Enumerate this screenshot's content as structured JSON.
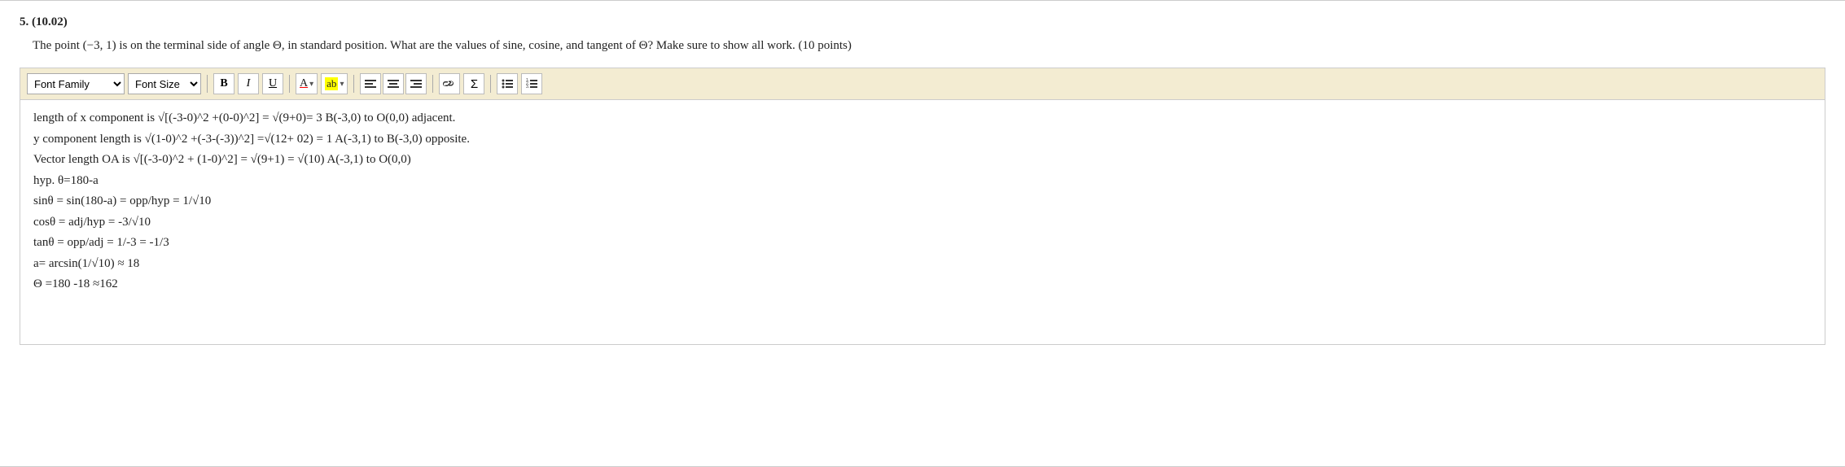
{
  "question": {
    "number": "5.",
    "points": "(10.02)",
    "header": "5. (10.02)",
    "text": "The point (−3, 1) is on the terminal side of angle Θ, in standard position. What are the values of sine, cosine, and tangent of Θ? Make sure to show all work. (10 points)"
  },
  "toolbar": {
    "font_family_label": "Font Family",
    "font_size_label": "Font Size",
    "bold_label": "B",
    "italic_label": "I",
    "underline_label": "U",
    "font_color_label": "A",
    "highlight_label": "ab",
    "align_left_label": "≡",
    "align_center_label": "≡",
    "align_right_label": "≡",
    "link_label": "🔗",
    "sigma_label": "Σ",
    "list_ul_label": "≡",
    "list_ol_label": "≡"
  },
  "content": {
    "lines": [
      " length of x component is √[(-3-0)^2 +(0-0)^2] = √(9+0)= 3  B(-3,0) to O(0,0) adjacent.",
      "y component length is √(1-0)^2 +(-3-(-3))^2] =√(12+ 02) = 1  A(-3,1) to B(-3,0) opposite.",
      "Vector length OA is √[(-3-0)^2 + (1-0)^2] = √(9+1) = √(10)  A(-3,1) to O(0,0)",
      "hyp. θ=180-a",
      "sinθ = sin(180-a) = opp/hyp = 1/√10",
      "cosθ = adj/hyp = -3/√10",
      "tanθ = opp/adj = 1/-3 = -1/3",
      "a= arcsin(1/√10) ≈ 18",
      "Θ =180 -18 ≈162"
    ]
  }
}
